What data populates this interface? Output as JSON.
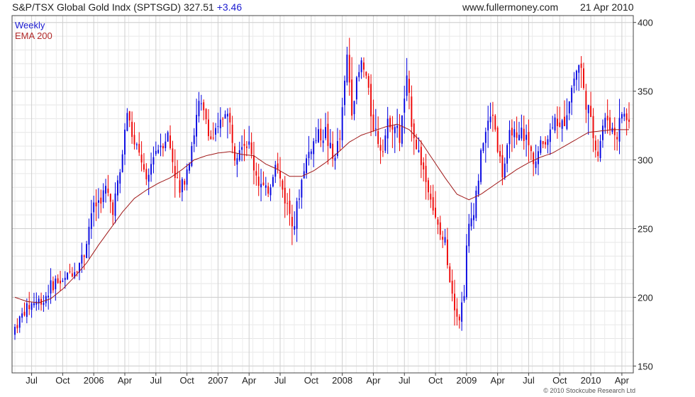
{
  "header": {
    "symbol_title": "S&P/TSX Global Gold Indx (SPTSGD) 327.51",
    "change": "+3.46",
    "website": "www.fullermoney.com",
    "date": "21 Apr 2010"
  },
  "legend": {
    "weekly": "Weekly",
    "ema": "EMA 200"
  },
  "copyright": "© 2010 Stockcube Research Ltd",
  "colors": {
    "up": "#0000e0",
    "down": "#ee0000",
    "ema": "#a01818",
    "grid": "#cfcfcf"
  },
  "chart_data": {
    "type": "candlestick",
    "period": "weekly",
    "ylim": [
      145,
      405
    ],
    "yticks": [
      150,
      200,
      250,
      300,
      350,
      400
    ],
    "grid": true,
    "x_tick_labels": [
      "Jul",
      "Oct",
      "2006",
      "Apr",
      "Jul",
      "Oct",
      "2007",
      "Apr",
      "Jul",
      "Oct",
      "2008",
      "Apr",
      "Jul",
      "Oct",
      "2009",
      "Apr",
      "Jul",
      "Oct",
      "2010",
      "Apr"
    ],
    "x_tick_indices": [
      7,
      20,
      33,
      46,
      59,
      72,
      85,
      98,
      111,
      124,
      137,
      150,
      163,
      176,
      189,
      202,
      215,
      228,
      241,
      254
    ],
    "close_anchors": [
      [
        0,
        178
      ],
      [
        4,
        190
      ],
      [
        8,
        197
      ],
      [
        12,
        198
      ],
      [
        14,
        205
      ],
      [
        17,
        212
      ],
      [
        20,
        210
      ],
      [
        23,
        218
      ],
      [
        26,
        222
      ],
      [
        29,
        232
      ],
      [
        32,
        262
      ],
      [
        35,
        270
      ],
      [
        38,
        278
      ],
      [
        41,
        265
      ],
      [
        44,
        290
      ],
      [
        47,
        335
      ],
      [
        50,
        310
      ],
      [
        53,
        300
      ],
      [
        55,
        280
      ],
      [
        58,
        305
      ],
      [
        61,
        312
      ],
      [
        64,
        318
      ],
      [
        66,
        300
      ],
      [
        69,
        275
      ],
      [
        72,
        295
      ],
      [
        75,
        320
      ],
      [
        77,
        340
      ],
      [
        80,
        330
      ],
      [
        82,
        315
      ],
      [
        85,
        320
      ],
      [
        88,
        338
      ],
      [
        90,
        325
      ],
      [
        92,
        306
      ],
      [
        95,
        315
      ],
      [
        98,
        310
      ],
      [
        100,
        295
      ],
      [
        102,
        285
      ],
      [
        105,
        275
      ],
      [
        107,
        283
      ],
      [
        109,
        300
      ],
      [
        111,
        285
      ],
      [
        113,
        272
      ],
      [
        115,
        262
      ],
      [
        117,
        255
      ],
      [
        119,
        275
      ],
      [
        121,
        295
      ],
      [
        124,
        310
      ],
      [
        127,
        318
      ],
      [
        130,
        320
      ],
      [
        133,
        300
      ],
      [
        136,
        315
      ],
      [
        139,
        375
      ],
      [
        141,
        340
      ],
      [
        143,
        355
      ],
      [
        145,
        370
      ],
      [
        147,
        360
      ],
      [
        149,
        335
      ],
      [
        151,
        320
      ],
      [
        153,
        310
      ],
      [
        155,
        318
      ],
      [
        157,
        330
      ],
      [
        159,
        325
      ],
      [
        161,
        315
      ],
      [
        163,
        345
      ],
      [
        164,
        355
      ],
      [
        166,
        330
      ],
      [
        168,
        310
      ],
      [
        170,
        300
      ],
      [
        172,
        285
      ],
      [
        174,
        275
      ],
      [
        176,
        255
      ],
      [
        178,
        245
      ],
      [
        180,
        240
      ],
      [
        182,
        215
      ],
      [
        184,
        195
      ],
      [
        186,
        185
      ],
      [
        188,
        205
      ],
      [
        189,
        235
      ],
      [
        190,
        250
      ],
      [
        192,
        265
      ],
      [
        194,
        288
      ],
      [
        196,
        315
      ],
      [
        198,
        325
      ],
      [
        200,
        335
      ],
      [
        202,
        310
      ],
      [
        204,
        290
      ],
      [
        206,
        305
      ],
      [
        208,
        325
      ],
      [
        210,
        310
      ],
      [
        212,
        320
      ],
      [
        214,
        315
      ],
      [
        216,
        305
      ],
      [
        218,
        300
      ],
      [
        220,
        310
      ],
      [
        222,
        315
      ],
      [
        224,
        320
      ],
      [
        226,
        335
      ],
      [
        228,
        320
      ],
      [
        230,
        330
      ],
      [
        232,
        345
      ],
      [
        234,
        360
      ],
      [
        236,
        370
      ],
      [
        237,
        365
      ],
      [
        238,
        350
      ],
      [
        240,
        335
      ],
      [
        242,
        318
      ],
      [
        244,
        305
      ],
      [
        246,
        325
      ],
      [
        248,
        330
      ],
      [
        250,
        322
      ],
      [
        252,
        318
      ],
      [
        254,
        335
      ],
      [
        256,
        330
      ],
      [
        257,
        327.51
      ]
    ],
    "ema_anchors": [
      [
        0,
        200
      ],
      [
        5,
        197
      ],
      [
        10,
        196
      ],
      [
        15,
        199
      ],
      [
        20,
        206
      ],
      [
        25,
        215
      ],
      [
        30,
        225
      ],
      [
        35,
        238
      ],
      [
        40,
        250
      ],
      [
        45,
        262
      ],
      [
        50,
        272
      ],
      [
        55,
        278
      ],
      [
        60,
        283
      ],
      [
        65,
        287
      ],
      [
        70,
        293
      ],
      [
        75,
        300
      ],
      [
        80,
        303
      ],
      [
        85,
        305
      ],
      [
        90,
        306
      ],
      [
        95,
        304
      ],
      [
        100,
        303
      ],
      [
        105,
        297
      ],
      [
        110,
        293
      ],
      [
        115,
        288
      ],
      [
        120,
        288
      ],
      [
        125,
        292
      ],
      [
        130,
        298
      ],
      [
        135,
        305
      ],
      [
        140,
        313
      ],
      [
        145,
        318
      ],
      [
        150,
        321
      ],
      [
        155,
        324
      ],
      [
        160,
        326
      ],
      [
        165,
        322
      ],
      [
        170,
        313
      ],
      [
        175,
        300
      ],
      [
        180,
        287
      ],
      [
        185,
        275
      ],
      [
        190,
        271
      ],
      [
        195,
        275
      ],
      [
        200,
        281
      ],
      [
        205,
        287
      ],
      [
        210,
        293
      ],
      [
        215,
        298
      ],
      [
        220,
        302
      ],
      [
        225,
        305
      ],
      [
        230,
        310
      ],
      [
        235,
        315
      ],
      [
        240,
        320
      ],
      [
        245,
        321
      ],
      [
        250,
        322
      ],
      [
        255,
        322
      ],
      [
        257,
        322
      ]
    ]
  }
}
